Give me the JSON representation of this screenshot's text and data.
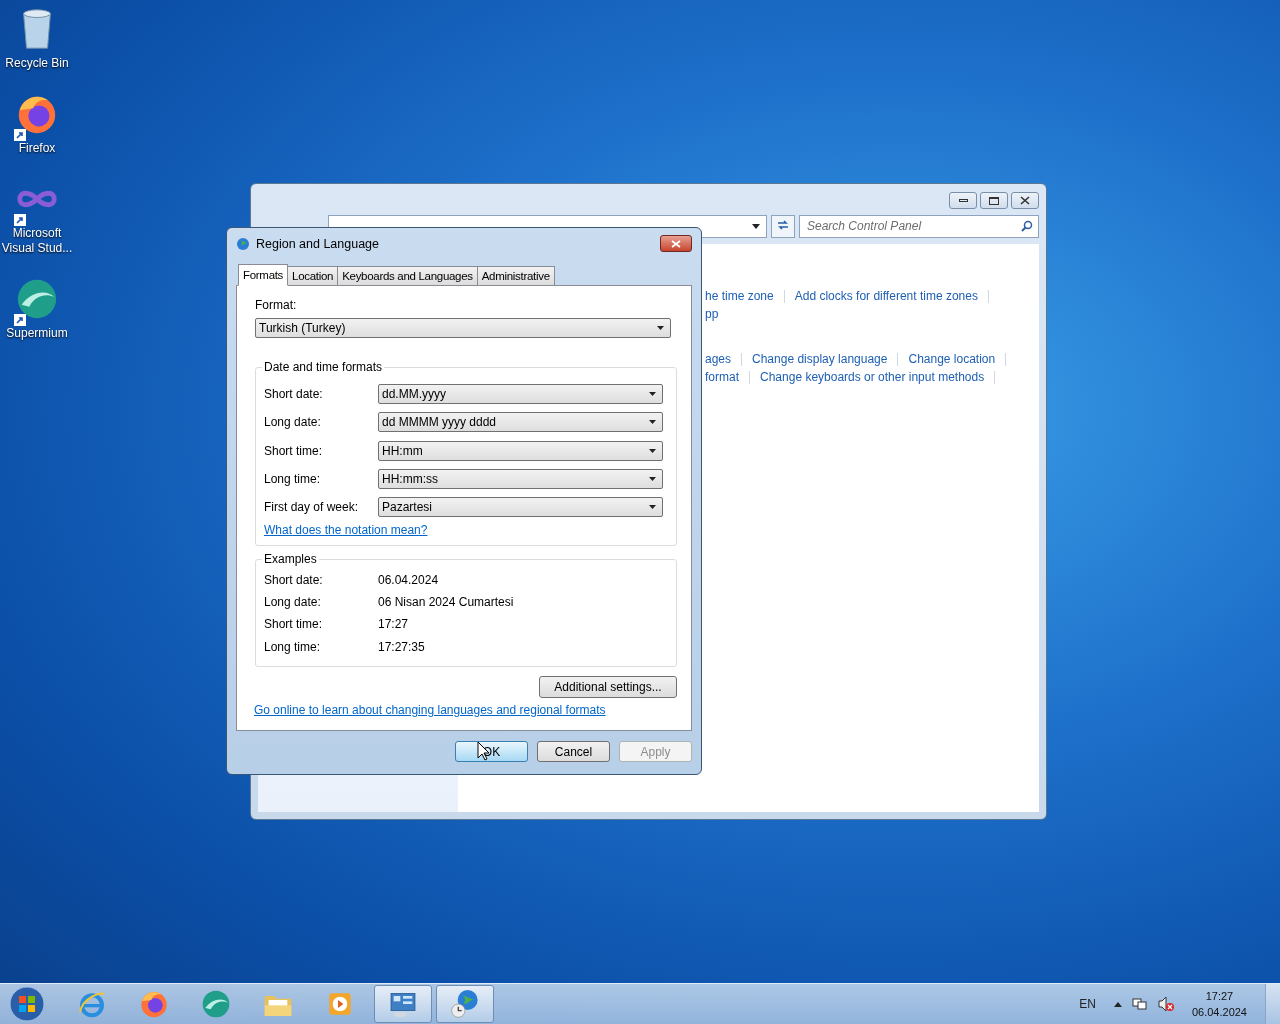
{
  "desktop_icons": [
    {
      "kind": "recycle",
      "label": "Recycle Bin",
      "shortcut": false
    },
    {
      "kind": "firefox",
      "label": "Firefox",
      "shortcut": true
    },
    {
      "kind": "vs",
      "label": "Microsoft Visual Stud...",
      "shortcut": true
    },
    {
      "kind": "supermium",
      "label": "Supermium",
      "shortcut": true
    }
  ],
  "control_panel": {
    "search": {
      "placeholder": "Search Control Panel"
    },
    "link_rows": [
      [
        "he time zone",
        "Add clocks for different time zones"
      ],
      [
        "pp"
      ],
      [
        "ages",
        "Change display language",
        "Change location"
      ],
      [
        "format",
        "Change keyboards or other input methods"
      ]
    ]
  },
  "dialog": {
    "title": "Region and Language",
    "tabs": [
      {
        "label": "Formats",
        "selected": true
      },
      {
        "label": "Location",
        "selected": false
      },
      {
        "label": "Keyboards and Languages",
        "selected": false
      },
      {
        "label": "Administrative",
        "selected": false
      }
    ],
    "format": {
      "label": "Format:",
      "value": "Turkish (Turkey)"
    },
    "date_time_formats": {
      "title": "Date and time formats",
      "fields": [
        {
          "label": "Short date:",
          "value": "dd.MM.yyyy"
        },
        {
          "label": "Long date:",
          "value": "dd MMMM yyyy dddd"
        },
        {
          "label": "Short time:",
          "value": "HH:mm"
        },
        {
          "label": "Long time:",
          "value": "HH:mm:ss"
        },
        {
          "label": "First day of week:",
          "value": "Pazartesi"
        }
      ],
      "link": "What does the notation mean?"
    },
    "examples": {
      "title": "Examples",
      "rows": [
        {
          "label": "Short date:",
          "value": "06.04.2024"
        },
        {
          "label": "Long date:",
          "value": "06 Nisan 2024 Cumartesi"
        },
        {
          "label": "Short time:",
          "value": "17:27"
        },
        {
          "label": "Long time:",
          "value": "17:27:35"
        }
      ]
    },
    "additional_button": "Additional settings...",
    "online_link": "Go online to learn about changing languages and regional formats",
    "buttons": [
      {
        "label": "OK",
        "default": true,
        "disabled": false
      },
      {
        "label": "Cancel",
        "default": false,
        "disabled": false
      },
      {
        "label": "Apply",
        "default": false,
        "disabled": true
      }
    ]
  },
  "taskbar": {
    "pinned": [
      {
        "kind": "ie"
      },
      {
        "kind": "firefox"
      },
      {
        "kind": "supermium"
      },
      {
        "kind": "explorer"
      },
      {
        "kind": "media"
      }
    ],
    "windows": [
      {
        "kind": "control"
      },
      {
        "kind": "globe"
      }
    ],
    "language": "EN",
    "time": "17:27",
    "date": "06.04.2024"
  }
}
